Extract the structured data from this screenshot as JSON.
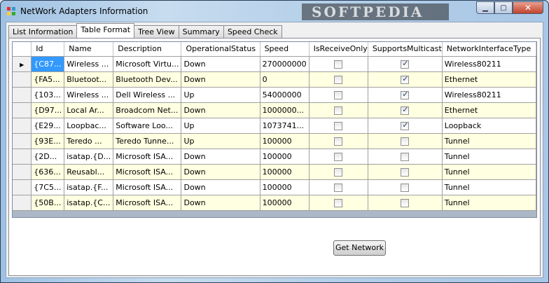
{
  "window": {
    "title": "NetWork Adapters Information",
    "watermark": "SOFTPEDIA"
  },
  "caption_buttons": {
    "minimize": "▁",
    "maximize": "▢",
    "close": "✕"
  },
  "tabs": [
    {
      "label": "List Information"
    },
    {
      "label": "Table Format"
    },
    {
      "label": "Tree View"
    },
    {
      "label": "Summary"
    },
    {
      "label": "Speed Check"
    }
  ],
  "active_tab": "Table Format",
  "grid": {
    "columns": [
      "Id",
      "Name",
      "Description",
      "OperationalStatus",
      "Speed",
      "IsReceiveOnly",
      "SupportsMulticast",
      "NetworkInterfaceType"
    ],
    "row_pointer": "▶",
    "rows": [
      {
        "id": "{C87...",
        "name": "Wireless ...",
        "description": "Microsoft Virtu...",
        "status": "Down",
        "speed": "270000000",
        "receive_only": false,
        "multicast": true,
        "type": "Wireless80211"
      },
      {
        "id": "{FA5...",
        "name": "Bluetoot...",
        "description": "Bluetooth Dev...",
        "status": "Down",
        "speed": "0",
        "receive_only": false,
        "multicast": true,
        "type": "Ethernet"
      },
      {
        "id": "{103...",
        "name": "Wireless ...",
        "description": "Dell Wireless ...",
        "status": "Up",
        "speed": "54000000",
        "receive_only": false,
        "multicast": true,
        "type": "Wireless80211"
      },
      {
        "id": "{D97...",
        "name": "Local Ar...",
        "description": "Broadcom Net...",
        "status": "Down",
        "speed": "1000000...",
        "receive_only": false,
        "multicast": true,
        "type": "Ethernet"
      },
      {
        "id": "{E29...",
        "name": "Loopbac...",
        "description": "Software Loo...",
        "status": "Up",
        "speed": "1073741...",
        "receive_only": false,
        "multicast": true,
        "type": "Loopback"
      },
      {
        "id": "{93E...",
        "name": "Teredo ...",
        "description": "Teredo Tunne...",
        "status": "Up",
        "speed": "100000",
        "receive_only": false,
        "multicast": false,
        "type": "Tunnel"
      },
      {
        "id": "{2D...",
        "name": "isatap.{D...",
        "description": "Microsoft ISA...",
        "status": "Down",
        "speed": "100000",
        "receive_only": false,
        "multicast": false,
        "type": "Tunnel"
      },
      {
        "id": "{636...",
        "name": "Reusabl...",
        "description": "Microsoft ISA...",
        "status": "Down",
        "speed": "100000",
        "receive_only": false,
        "multicast": false,
        "type": "Tunnel"
      },
      {
        "id": "{7C5...",
        "name": "isatap.{F...",
        "description": "Microsoft ISA...",
        "status": "Down",
        "speed": "100000",
        "receive_only": false,
        "multicast": false,
        "type": "Tunnel"
      },
      {
        "id": "{50B...",
        "name": "isatap.{C...",
        "description": "Microsoft ISA...",
        "status": "Down",
        "speed": "100000",
        "receive_only": false,
        "multicast": false,
        "type": "Tunnel"
      }
    ]
  },
  "buttons": {
    "get_network": "Get Network"
  },
  "colors": {
    "selection": "#3399ff",
    "alt_row": "#ffffe1",
    "grid_background": "#acb7c7"
  }
}
